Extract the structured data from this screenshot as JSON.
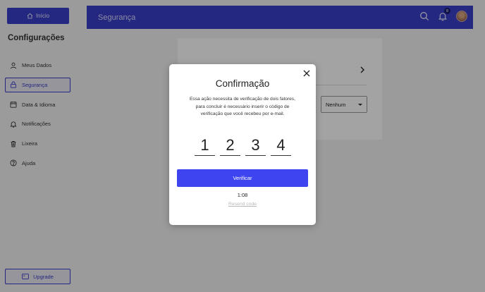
{
  "sidebar": {
    "home_label": "Início",
    "title": "Configurações",
    "items": [
      {
        "label": "Meus Dados",
        "icon": "user-icon"
      },
      {
        "label": "Segurança",
        "icon": "lock-icon",
        "active": true
      },
      {
        "label": "Data & Idioma",
        "icon": "calendar-icon"
      },
      {
        "label": "Notificações",
        "icon": "bell-icon"
      },
      {
        "label": "Lixeira",
        "icon": "trash-icon"
      },
      {
        "label": "Ajuda",
        "icon": "help-icon"
      }
    ],
    "upgrade_label": "Upgrade"
  },
  "header": {
    "title": "Segurança",
    "notification_count": "8",
    "icons": [
      "search-icon",
      "bell-icon",
      "avatar"
    ]
  },
  "content": {
    "select_value": "Nenhum"
  },
  "modal": {
    "title": "Confirmação",
    "description": "Essa ação necessita de verificação de dois fatores, para concluir é necessário inserir o código de verificação que você recebeu por e-mail.",
    "code": [
      "1",
      "2",
      "3",
      "4"
    ],
    "verify_label": "Verificar",
    "timer": "1:08",
    "resend_label": "Resend code"
  },
  "colors": {
    "primary": "#3a3fc9",
    "button": "#3e44f0",
    "overlay": "rgba(0,0,0,0.36)"
  }
}
